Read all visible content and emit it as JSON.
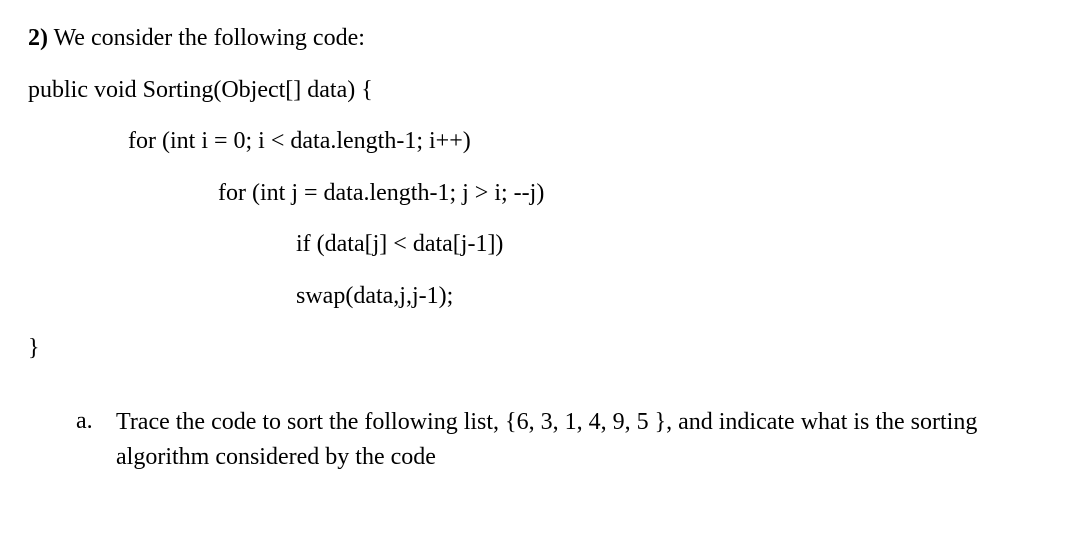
{
  "question": {
    "number": "2)",
    "prompt": "We consider the following code:"
  },
  "code": {
    "line1": "public void Sorting(Object[] data) {",
    "line2": "for (int i = 0; i < data.length-1; i++)",
    "line3": "for (int j = data.length-1; j > i; --j)",
    "line4": "if (data[j] < data[j-1])",
    "line5": "swap(data,j,j-1);",
    "line6": "}"
  },
  "subquestion": {
    "marker": "a.",
    "text": "Trace the code to sort the following list, {6, 3, 1, 4, 9, 5 }, and indicate what is the sorting algorithm considered by the code"
  }
}
